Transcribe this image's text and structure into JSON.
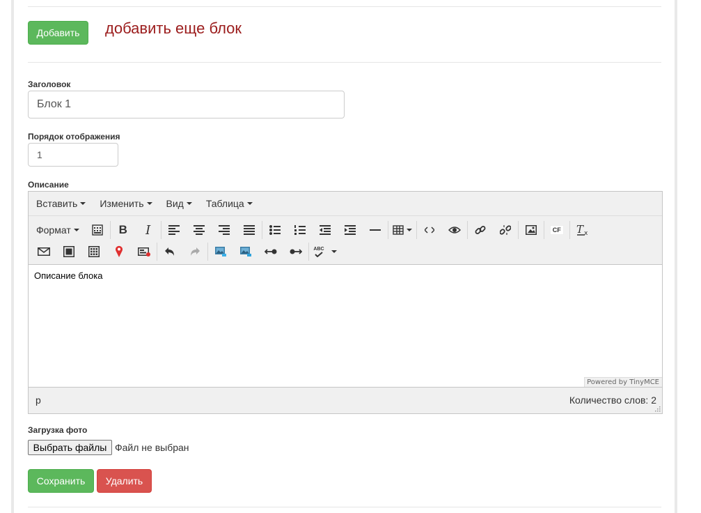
{
  "top": {
    "add_button": "Добавить",
    "add_caption": "добавить еще блок"
  },
  "title_field": {
    "label": "Заголовок",
    "value": "Блок 1"
  },
  "order_field": {
    "label": "Порядок отображения",
    "value": "1"
  },
  "description": {
    "label": "Описание",
    "menu": [
      "Вставить",
      "Изменить",
      "Вид",
      "Таблица"
    ],
    "format_label": "Формат",
    "toolbar_icons_row1": [
      "table-grid-icon",
      "bold-icon",
      "italic-icon",
      "align-left-icon",
      "align-center-icon",
      "align-right-icon",
      "align-justify-icon",
      "bullet-list-icon",
      "numbered-list-icon",
      "outdent-icon",
      "indent-icon",
      "horizontal-rule-icon",
      "table-icon",
      "code-icon",
      "preview-icon",
      "link-icon",
      "unlink-icon",
      "image-icon",
      "cf-icon",
      "clear-format-icon"
    ],
    "toolbar_icons_row2": [
      "mail-icon",
      "square-icon",
      "grid-icon",
      "map-pin-icon",
      "media-icon",
      "undo-icon",
      "redo-icon",
      "image-left-icon",
      "image-right-icon",
      "ltr-icon",
      "rtl-icon",
      "spellcheck-icon"
    ],
    "bold": "B",
    "italic": "I",
    "cf": "CF",
    "spell": "ABC",
    "content": "Описание блока",
    "powered_by": "Powered by TinyMCE",
    "path": "p",
    "word_count": "Количество слов: 2"
  },
  "photo": {
    "label": "Загрузка фото",
    "file_button": "Выбрать файлы",
    "file_note": "Файл не выбран"
  },
  "actions": {
    "save": "Сохранить",
    "delete": "Удалить"
  },
  "colors": {
    "green": "#5cb85c",
    "red": "#d9534f",
    "caption": "#9b1c1c"
  }
}
